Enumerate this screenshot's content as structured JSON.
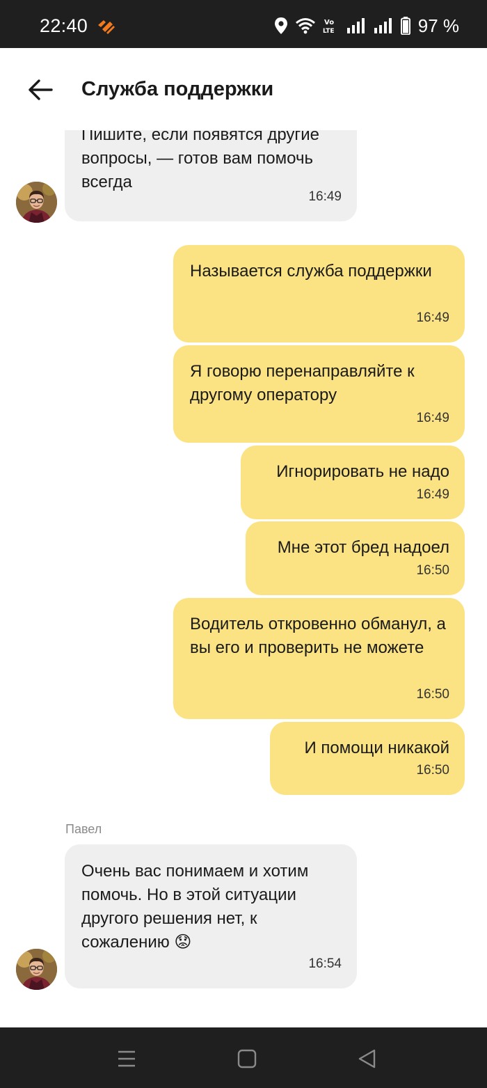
{
  "status_bar": {
    "time": "22:40",
    "battery_text": "97 %",
    "icons": [
      "location-icon",
      "wifi-icon",
      "volte-icon",
      "signal-icon",
      "signal-icon",
      "battery-icon"
    ]
  },
  "header": {
    "title": "Служба поддержки",
    "back_icon": "arrow-left-icon"
  },
  "messages": [
    {
      "direction": "in",
      "text": "Пишите, если появятся другие вопросы, — готов вам помочь всегда",
      "time": "16:49"
    },
    {
      "direction": "out",
      "text": "Называется служба поддержки",
      "time": "16:49"
    },
    {
      "direction": "out",
      "text": "Я говорю перенаправляйте к другому оператору",
      "time": "16:49"
    },
    {
      "direction": "out",
      "text": "Игнорировать не надо",
      "time": "16:49"
    },
    {
      "direction": "out",
      "text": "Мне этот бред надоел",
      "time": "16:50"
    },
    {
      "direction": "out",
      "text": "Водитель откровенно обманул, а вы его и проверить не можете",
      "time": "16:50"
    },
    {
      "direction": "out",
      "text": "И помощи никакой",
      "time": "16:50"
    },
    {
      "direction": "in",
      "sender": "Павел",
      "text": "Очень вас понимаем и хотим помочь. Но в этой ситуации другого решения нет, к сожалению 😟",
      "time": "16:54"
    }
  ],
  "colors": {
    "outgoing_bubble": "#fbe383",
    "incoming_bubble": "#efefef",
    "system_bar": "#1f1f1f",
    "accent_orange": "#f47a20"
  },
  "nav_bar": {
    "icons": [
      "recent-apps-icon",
      "home-icon",
      "back-triangle-icon"
    ]
  }
}
